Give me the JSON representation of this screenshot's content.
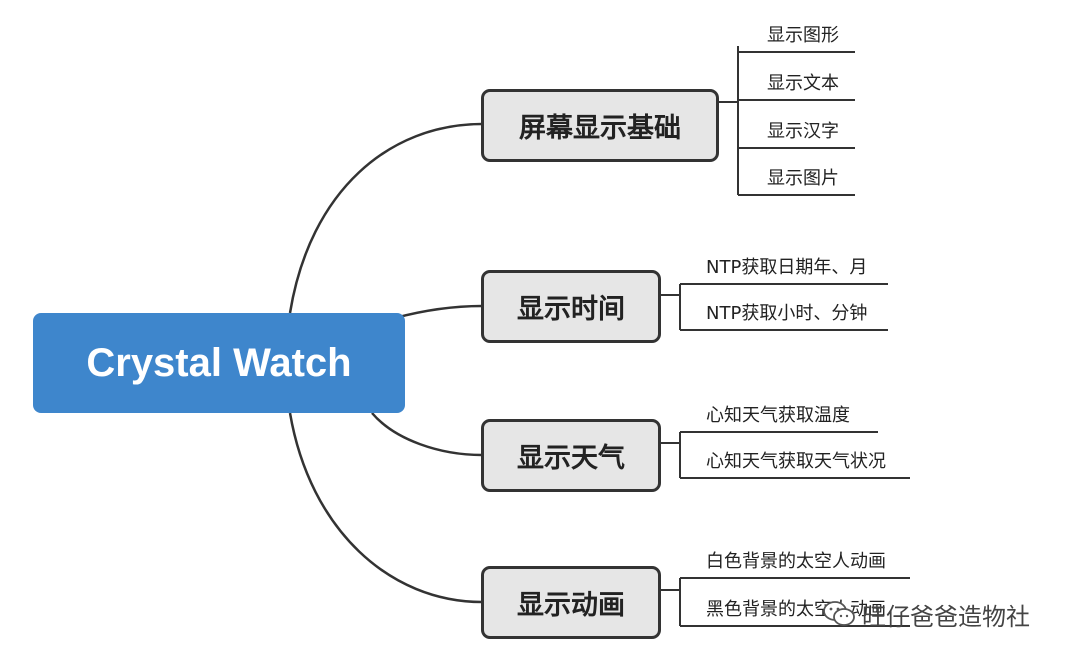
{
  "root": {
    "label": "Crystal Watch"
  },
  "branches": [
    {
      "label": "屏幕显示基础",
      "items": [
        "显示图形",
        "显示文本",
        "显示汉字",
        "显示图片"
      ]
    },
    {
      "label": "显示时间",
      "items": [
        "NTP获取日期年、月",
        "NTP获取小时、分钟"
      ]
    },
    {
      "label": "显示天气",
      "items": [
        "心知天气获取温度",
        "心知天气获取天气状况"
      ]
    },
    {
      "label": "显示动画",
      "items": [
        "白色背景的太空人动画",
        "黑色背景的太空人动画"
      ]
    }
  ],
  "watermark": {
    "text": "旺仔爸爸造物社",
    "icon": "wechat-icon"
  },
  "colors": {
    "root_fill": "#3e86cc",
    "branch_fill": "#e6e6e6",
    "line": "#333333"
  }
}
